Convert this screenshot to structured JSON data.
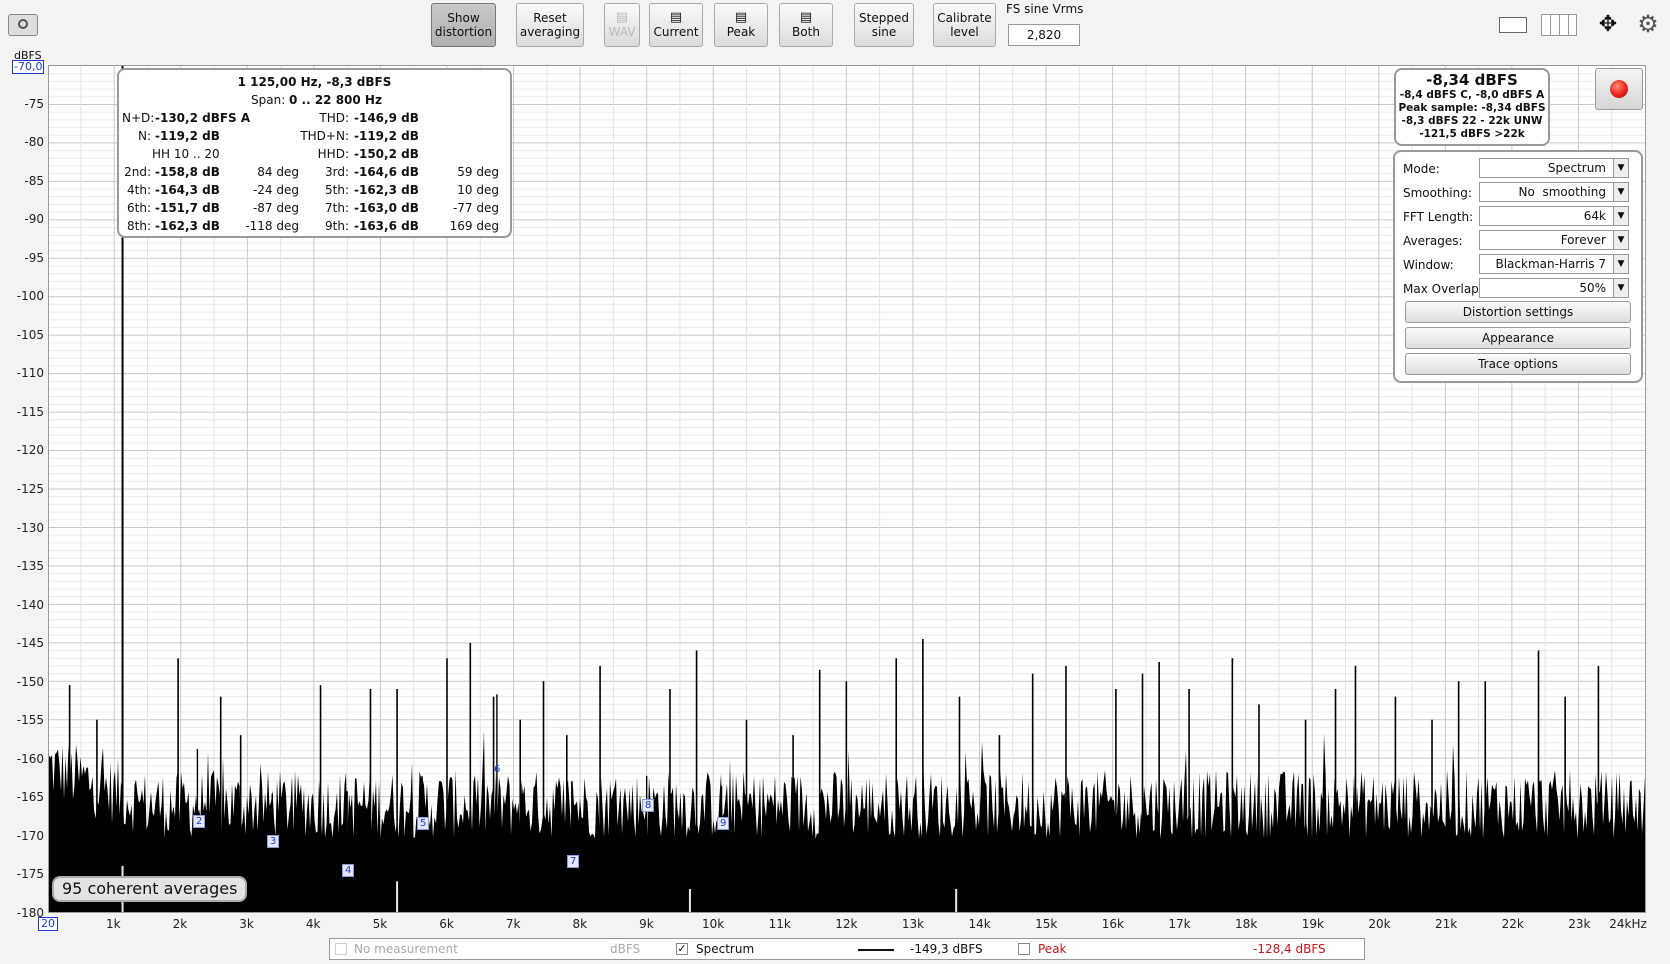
{
  "toolbar": {
    "show_distortion": "Show\ndistortion",
    "reset_averaging": "Reset\naveraging",
    "wav": "WAV",
    "current": "Current",
    "peak": "Peak",
    "both": "Both",
    "stepped_sine": "Stepped\nsine",
    "calibrate_level": "Calibrate\nlevel",
    "fs_label": "FS sine Vrms",
    "fs_value": "2,820"
  },
  "axis": {
    "y_unit": "dBFS",
    "y_top_value": "-70,0",
    "x_first": "20",
    "y_ticks": [
      "-75",
      "-80",
      "-85",
      "-90",
      "-95",
      "-100",
      "-105",
      "-110",
      "-115",
      "-120",
      "-125",
      "-130",
      "-135",
      "-140",
      "-145",
      "-150",
      "-155",
      "-160",
      "-165",
      "-170",
      "-175",
      "-180"
    ],
    "x_ticks": [
      "1k",
      "2k",
      "3k",
      "4k",
      "5k",
      "6k",
      "7k",
      "8k",
      "9k",
      "10k",
      "11k",
      "12k",
      "13k",
      "14k",
      "15k",
      "16k",
      "17k",
      "18k",
      "19k",
      "20k",
      "21k",
      "22k",
      "23k",
      "24kHz"
    ]
  },
  "distortion": {
    "title": "1 125,00 Hz, -8,3 dBFS",
    "span_label": "Span:",
    "span_value": "0 .. 22 800 Hz",
    "nd_label": "N+D:",
    "nd_value": "-130,2 dBFS A",
    "thd_label": "THD:",
    "thd_value": "-146,9 dB",
    "n_label": "N:",
    "n_value": "-119,2 dB",
    "thdn_label": "THD+N:",
    "thdn_value": "-119,2 dB",
    "hh_label": "HH 10 .. 20",
    "hhd_label": "HHD:",
    "hhd_value": "-150,2 dB",
    "harmonics": [
      {
        "l1": "2nd:",
        "v1": "-158,8 dB",
        "p1": "84 deg",
        "l2": "3rd:",
        "v2": "-164,6 dB",
        "p2": "59 deg"
      },
      {
        "l1": "4th:",
        "v1": "-164,3 dB",
        "p1": "-24 deg",
        "l2": "5th:",
        "v2": "-162,3 dB",
        "p2": "10 deg"
      },
      {
        "l1": "6th:",
        "v1": "-151,7 dB",
        "p1": "-87 deg",
        "l2": "7th:",
        "v2": "-163,0 dB",
        "p2": "-77 deg"
      },
      {
        "l1": "8th:",
        "v1": "-162,3 dB",
        "p1": "-118 deg",
        "l2": "9th:",
        "v2": "-163,6 dB",
        "p2": "169 deg"
      }
    ]
  },
  "level": {
    "main": "-8,34 dBFS",
    "line1": "-8,4 dBFS C, -8,0 dBFS A",
    "line2": "Peak sample: -8,34 dBFS",
    "line3": "-8,3 dBFS 22 - 22k UNW",
    "line4": "-121,5 dBFS >22k"
  },
  "settings": {
    "mode_label": "Mode:",
    "mode_value": "Spectrum",
    "smoothing_label": "Smoothing:",
    "smoothing_value": "No  smoothing",
    "fft_label": "FFT Length:",
    "fft_value": "64k",
    "averages_label": "Averages:",
    "averages_value": "Forever",
    "window_label": "Window:",
    "window_value": "Blackman-Harris 7",
    "overlap_label": "Max Overlap:",
    "overlap_value": "50%",
    "distortion_settings": "Distortion settings",
    "appearance": "Appearance",
    "trace_options": "Trace options"
  },
  "averages_badge": "95 coherent averages",
  "markers": [
    "2",
    "3",
    "4",
    "5",
    "6",
    "7",
    "8",
    "9"
  ],
  "legend": {
    "no_measurement": "No measurement",
    "dbfs": "dBFS",
    "spectrum": "Spectrum",
    "spectrum_value": "-149,3 dBFS",
    "peak": "Peak",
    "peak_value": "-128,4 dBFS"
  },
  "colors": {
    "record": "#e8231a",
    "peak_text": "#c0191f",
    "marker": "#1a3ad8"
  },
  "chart_data": {
    "type": "line",
    "xlabel": "",
    "ylabel": "dBFS",
    "ylim": [
      -180,
      -70
    ],
    "xlim": [
      20,
      24000
    ],
    "series": [
      {
        "name": "Spectrum",
        "x": [
          1125,
          2250,
          3375,
          4500,
          5625,
          6750,
          7875,
          9000,
          10125
        ],
        "y": [
          -8.3,
          -158.8,
          -164.6,
          -164.3,
          -162.3,
          -151.7,
          -163.0,
          -162.3,
          -163.6
        ]
      }
    ],
    "spurs": [
      {
        "x": 330,
        "y": -150.5
      },
      {
        "x": 740,
        "y": -155
      },
      {
        "x": 1960,
        "y": -147
      },
      {
        "x": 2600,
        "y": -152
      },
      {
        "x": 2900,
        "y": -157
      },
      {
        "x": 4100,
        "y": -150.5
      },
      {
        "x": 4850,
        "y": -151
      },
      {
        "x": 5250,
        "y": -151
      },
      {
        "x": 6000,
        "y": -147
      },
      {
        "x": 6350,
        "y": -145
      },
      {
        "x": 6700,
        "y": -152
      },
      {
        "x": 7100,
        "y": -155
      },
      {
        "x": 7450,
        "y": -150
      },
      {
        "x": 7800,
        "y": -157
      },
      {
        "x": 8300,
        "y": -148
      },
      {
        "x": 9350,
        "y": -151
      },
      {
        "x": 9750,
        "y": -146
      },
      {
        "x": 10500,
        "y": -155
      },
      {
        "x": 11200,
        "y": -157
      },
      {
        "x": 11600,
        "y": -148.5
      },
      {
        "x": 12000,
        "y": -150
      },
      {
        "x": 12750,
        "y": -147
      },
      {
        "x": 13150,
        "y": -144.5
      },
      {
        "x": 13700,
        "y": -152
      },
      {
        "x": 14300,
        "y": -157
      },
      {
        "x": 14800,
        "y": -149
      },
      {
        "x": 15300,
        "y": -148
      },
      {
        "x": 16050,
        "y": -151
      },
      {
        "x": 16450,
        "y": -149
      },
      {
        "x": 16700,
        "y": -147.5
      },
      {
        "x": 17150,
        "y": -151
      },
      {
        "x": 17800,
        "y": -147
      },
      {
        "x": 18200,
        "y": -153
      },
      {
        "x": 18900,
        "y": -155
      },
      {
        "x": 19350,
        "y": -151
      },
      {
        "x": 19650,
        "y": -148
      },
      {
        "x": 20250,
        "y": -152
      },
      {
        "x": 20800,
        "y": -155
      },
      {
        "x": 21200,
        "y": -150
      },
      {
        "x": 21600,
        "y": -150
      },
      {
        "x": 22400,
        "y": -146
      },
      {
        "x": 22800,
        "y": -152
      },
      {
        "x": 23300,
        "y": -148
      }
    ]
  }
}
